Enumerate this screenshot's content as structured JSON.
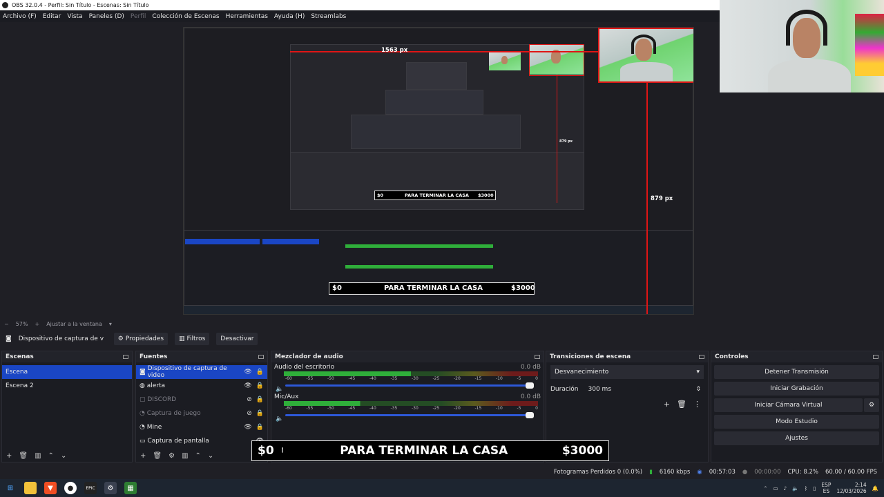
{
  "window": {
    "title": "OBS 32.0.4 - Perfil: Sin Título - Escenas: Sin Título"
  },
  "menu": {
    "items": [
      "Archivo (F)",
      "Editar",
      "Vista",
      "Paneles (D)",
      "Perfil",
      "Colección de Escenas",
      "Herramientas",
      "Ayuda (H)",
      "Streamlabs"
    ],
    "disabled_item": "Perfil"
  },
  "preview": {
    "px_top": "1563 px",
    "px_right": "879 px",
    "px_mid": "879 px",
    "inner_amount_left": "$0",
    "inner_text": "PARA TERMINAR LA CASA",
    "inner_amount_right": "$3000"
  },
  "zoom": {
    "minus": "−",
    "level": "57%",
    "plus": "+",
    "fit": "Ajustar a la ventana"
  },
  "source_toolbar": {
    "source": "Dispositivo de captura de v",
    "props": "Propiedades",
    "filters": "Filtros",
    "deactivate": "Desactivar"
  },
  "scenes": {
    "title": "Escenas",
    "items": [
      "Escena",
      "Escena 2"
    ]
  },
  "sources": {
    "title": "Fuentes",
    "items": [
      {
        "label": "Dispositivo de captura de video",
        "disabled": false
      },
      {
        "label": "alerta",
        "disabled": false
      },
      {
        "label": "DISCORD",
        "disabled": true
      },
      {
        "label": "Captura de juego",
        "disabled": true
      },
      {
        "label": "Mine",
        "disabled": false
      },
      {
        "label": "Captura de pantalla",
        "disabled": false
      }
    ]
  },
  "mixer": {
    "title": "Mezclador de audio",
    "channels": [
      {
        "name": "Audio del escritorio",
        "db": "0.0 dB",
        "level": 0.5
      },
      {
        "name": "Mic/Aux",
        "db": "0.0 dB",
        "level": 0.3
      }
    ],
    "ticks": [
      "-60",
      "-55",
      "-50",
      "-45",
      "-40",
      "-35",
      "-30",
      "-25",
      "-20",
      "-15",
      "-10",
      "-5",
      "0"
    ]
  },
  "transitions": {
    "title": "Transiciones de escena",
    "selected": "Desvanecimiento",
    "duration_label": "Duración",
    "duration_value": "300 ms"
  },
  "controls": {
    "title": "Controles",
    "buttons": [
      "Detener Transmisión",
      "Iniciar Grabación",
      "Iniciar Cámara Virtual",
      "Modo Estudio",
      "Ajustes"
    ]
  },
  "overlay": {
    "left": "$0",
    "text": "PARA TERMINAR LA CASA",
    "right": "$3000"
  },
  "status": {
    "frames": "Fotogramas Perdidos 0 (0.0%)",
    "kbps": "6160 kbps",
    "stream_time": "00:57:03",
    "rec_time": "00:00:00",
    "cpu": "CPU: 8.2%",
    "fps": "60.00 / 60.00 FPS"
  },
  "taskbar": {
    "lang_top": "ESP",
    "lang_bottom": "ES",
    "time": "2:14",
    "date": "12/03/2026"
  },
  "colors": {
    "accent": "#1a46c4",
    "guide": "#e01515",
    "meter_green": "#2fae3a"
  }
}
